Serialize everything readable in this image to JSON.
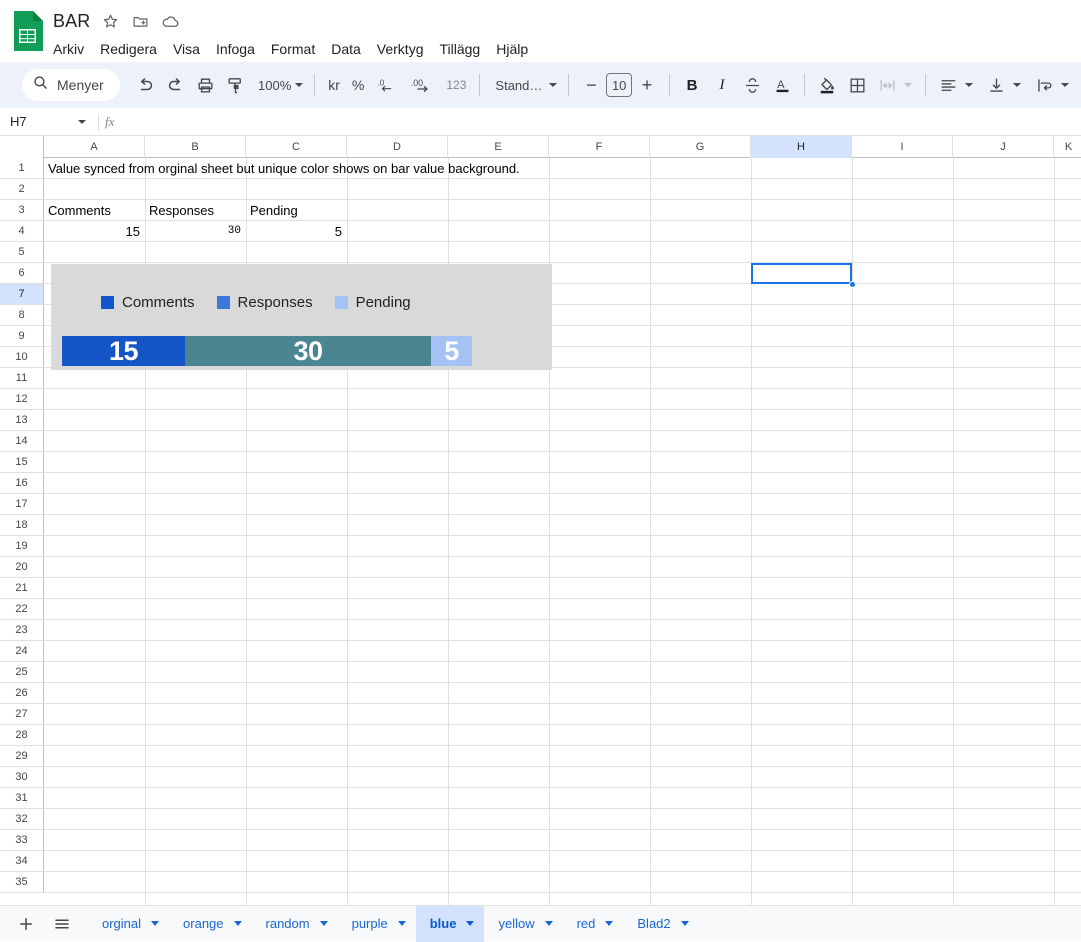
{
  "app": {
    "logo_icon": "sheets-logo-icon",
    "doc_title": "BAR",
    "title_icons": [
      {
        "name": "star-icon",
        "glyph": "☆"
      },
      {
        "name": "move-to-folder-icon",
        "glyph": "὜0"
      },
      {
        "name": "cloud-saved-icon",
        "glyph": "cloud"
      }
    ]
  },
  "menubar": {
    "items": [
      {
        "name": "menu-arkiv",
        "label": "Arkiv"
      },
      {
        "name": "menu-redigera",
        "label": "Redigera"
      },
      {
        "name": "menu-visa",
        "label": "Visa"
      },
      {
        "name": "menu-infoga",
        "label": "Infoga"
      },
      {
        "name": "menu-format",
        "label": "Format"
      },
      {
        "name": "menu-data",
        "label": "Data"
      },
      {
        "name": "menu-verktyg",
        "label": "Verktyg"
      },
      {
        "name": "menu-tillagg",
        "label": "Tillägg"
      },
      {
        "name": "menu-hjalp",
        "label": "Hjälp"
      }
    ]
  },
  "toolbar": {
    "search_label": "Menyer",
    "undo_label": "↶",
    "redo_label": "↷",
    "zoom_value": "100%",
    "currency_label": "kr",
    "percent_label": "%",
    "decrease_decimal_label": ".0",
    "increase_decimal_label": ".00",
    "number_format_label": "123",
    "font_name": "Stand…",
    "font_size": "10",
    "bold_label": "B",
    "italic_label": "I",
    "strikethrough_label": "S",
    "text_color_label": "A",
    "minus_label": "−",
    "plus_label": "+"
  },
  "formula_bar": {
    "cell_reference": "H7",
    "fx_label": "fx",
    "formula_value": ""
  },
  "grid": {
    "columns": [
      "A",
      "B",
      "C",
      "D",
      "E",
      "F",
      "G",
      "H",
      "I",
      "J",
      "K"
    ],
    "selected_column": "H",
    "selected_row": "7",
    "rows": [
      "1",
      "2",
      "3",
      "4",
      "5",
      "6",
      "7",
      "8",
      "9",
      "10",
      "11",
      "12",
      "13",
      "14",
      "15",
      "16",
      "17",
      "18",
      "19",
      "20",
      "21",
      "22",
      "23",
      "24",
      "25",
      "26",
      "27",
      "28",
      "29",
      "30",
      "31",
      "32",
      "33",
      "34",
      "35"
    ],
    "cells": [
      {
        "name": "cell-a1",
        "ref": "A1",
        "value": "Value synced from orginal sheet but unique color shows on bar value background.",
        "align": "left"
      },
      {
        "name": "cell-a3",
        "ref": "A3",
        "value": "Comments",
        "align": "left"
      },
      {
        "name": "cell-b3",
        "ref": "B3",
        "value": "Responses",
        "align": "left"
      },
      {
        "name": "cell-c3",
        "ref": "C3",
        "value": "Pending",
        "align": "left"
      },
      {
        "name": "cell-a4",
        "ref": "A4",
        "value": "15",
        "align": "right"
      },
      {
        "name": "cell-b4",
        "ref": "B4",
        "value": "30",
        "align": "right"
      },
      {
        "name": "cell-c4",
        "ref": "C4",
        "value": "5",
        "align": "right"
      }
    ]
  },
  "chart_data": {
    "type": "bar",
    "title": "",
    "orientation": "horizontal-stacked",
    "categories": [
      "Comments",
      "Responses",
      "Pending"
    ],
    "values": [
      15,
      30,
      5
    ],
    "data_labels": [
      "15",
      "30",
      "5"
    ],
    "legend": [
      {
        "label": "Comments",
        "swatch_color": "#1155cc"
      },
      {
        "label": "Responses",
        "swatch_color": "#3c78d8"
      },
      {
        "label": "Pending",
        "swatch_color": "#a4c2f4"
      }
    ],
    "bar_segment_colors": [
      "#1456c8",
      "#4a8591",
      "#a4c2f4"
    ],
    "background_color": "#d9d9d9",
    "legend_position": "top",
    "grid": false,
    "xlabel": "",
    "ylabel": ""
  },
  "sheet_tabs": {
    "add_label": "+",
    "all_sheets_label": "☰",
    "tabs": [
      {
        "name": "sheet-tab-orginal",
        "label": "orginal",
        "active": false
      },
      {
        "name": "sheet-tab-orange",
        "label": "orange",
        "active": false
      },
      {
        "name": "sheet-tab-random",
        "label": "random",
        "active": false
      },
      {
        "name": "sheet-tab-purple",
        "label": "purple",
        "active": false
      },
      {
        "name": "sheet-tab-blue",
        "label": "blue",
        "active": true
      },
      {
        "name": "sheet-tab-yellow",
        "label": "yellow",
        "active": false
      },
      {
        "name": "sheet-tab-red",
        "label": "red",
        "active": false
      },
      {
        "name": "sheet-tab-blad2",
        "label": "Blad2",
        "active": false
      }
    ]
  },
  "colors": {
    "toolbar_bg": "#edf2fa",
    "selection_blue": "#1a73e8",
    "header_selected": "#d3e3fd",
    "tab_active_text": "#0b57d0"
  }
}
